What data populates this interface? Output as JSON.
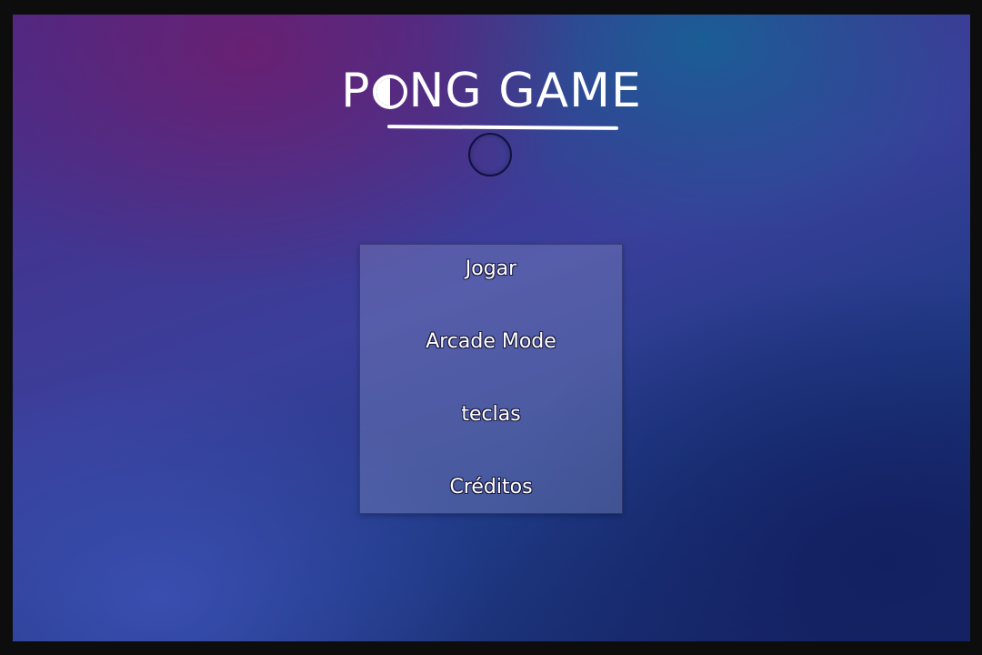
{
  "title": {
    "before": "P",
    "after": "NG GAME",
    "accent_color": "#ffffff"
  },
  "menu": {
    "items": [
      {
        "label": "Jogar"
      },
      {
        "label": "Arcade Mode"
      },
      {
        "label": "teclas"
      },
      {
        "label": "Créditos"
      }
    ]
  },
  "colors": {
    "background_purple": "#4a2a86",
    "background_blue": "#172766",
    "panel": "rgba(140,150,200,0.35)",
    "text": "#ffffff"
  }
}
